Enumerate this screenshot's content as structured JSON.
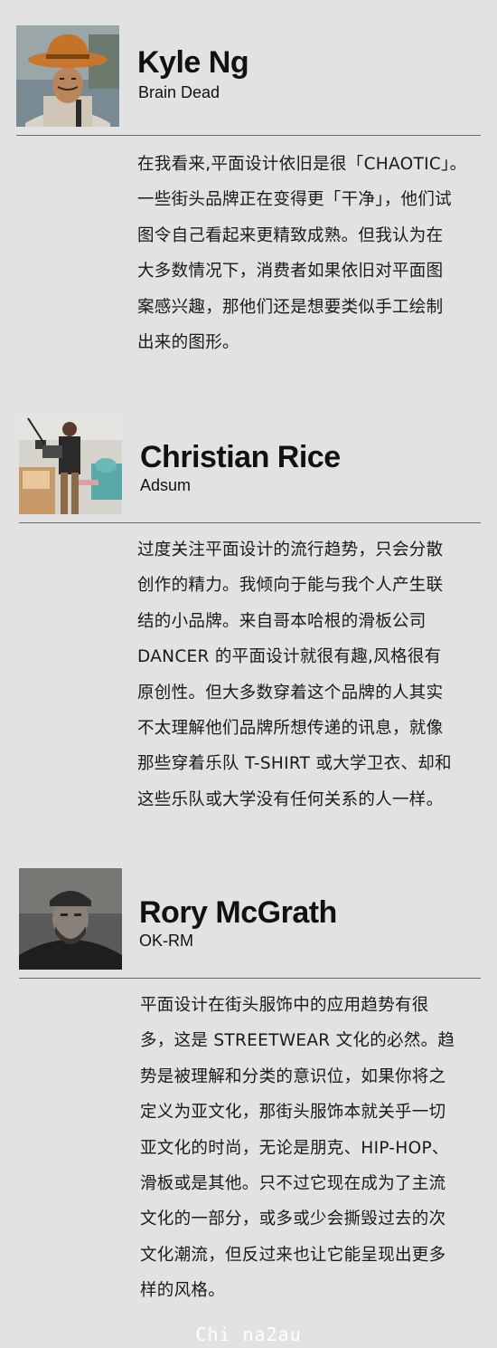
{
  "profiles": [
    {
      "name": "Kyle Ng",
      "org": "Brain Dead",
      "lines": [
        "在我看来,平面设计依旧是很「CHAOTIC」。",
        "一些街头品牌正在变得更「干净」，他们试",
        "图令自己看起来更精致成熟。但我认为在",
        "大多数情况下，消费者如果依旧对平面图",
        "案感兴趣，那他们还是想要类似手工绘制",
        "出来的图形。"
      ]
    },
    {
      "name": "Christian Rice",
      "org": "Adsum",
      "lines": [
        "过度关注平面设计的流行趋势，只会分散",
        "创作的精力。我倾向于能与我个人产生联",
        "结的小品牌。来自哥本哈根的滑板公司",
        "DANCER 的平面设计就很有趣,风格很有",
        "原创性。但大多数穿着这个品牌的人其实",
        "不太理解他们品牌所想传递的讯息，就像",
        "那些穿着乐队 T-SHIRT 或大学卫衣、却和",
        "这些乐队或大学没有任何关系的人一样。"
      ]
    },
    {
      "name": "Rory McGrath",
      "org": "OK-RM",
      "lines": [
        "平面设计在街头服饰中的应用趋势有很",
        "多，这是 STREETWEAR 文化的必然。趋",
        "势是被理解和分类的意识位，如果你将之",
        "定义为亚文化，那街头服饰本就关乎一切",
        "亚文化的时尚，无论是朋克、HIP-HOP、",
        "滑板或是其他。只不过它现在成为了主流",
        "文化的一部分，或多或少会撕毁过去的次",
        "文化潮流，但反过来也让它能呈现出更多",
        "样的风格。"
      ]
    }
  ],
  "watermark": "Chi na2au"
}
